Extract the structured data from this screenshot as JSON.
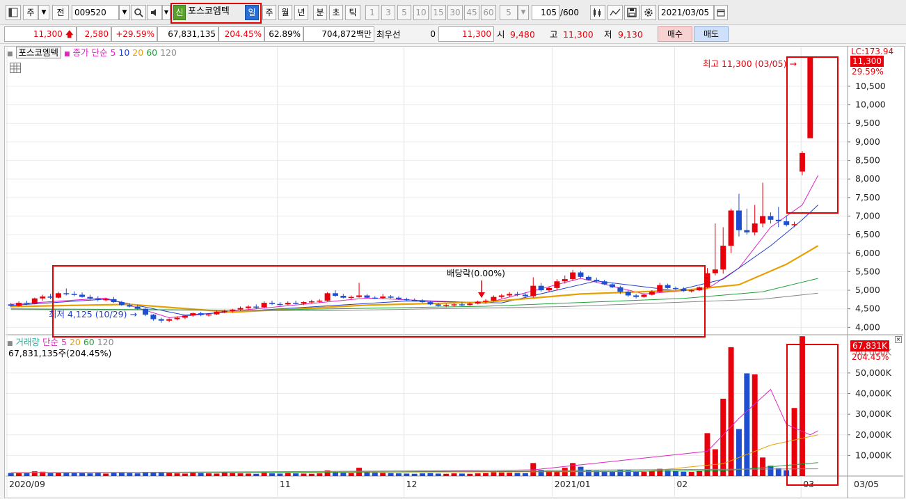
{
  "toolbar": {
    "market": "주",
    "mode": "전",
    "code": "009520",
    "credit_badge": "신",
    "stock_name": "포스코엠텍",
    "periods": [
      "일",
      "주",
      "월",
      "년",
      "분",
      "초",
      "틱"
    ],
    "minute_options": [
      "1",
      "3",
      "5",
      "10",
      "15",
      "30",
      "45",
      "60"
    ],
    "count_select": "5",
    "count_value": "105",
    "count_total": "/600",
    "date": "2021/03/05",
    "icons": [
      "window-icon",
      "search-icon",
      "volume-icon",
      "candle-settings-icon",
      "line-chart-icon",
      "save-icon",
      "gear-icon",
      "calendar-icon"
    ]
  },
  "quote": {
    "price": "11,300",
    "change": "2,580",
    "change_rate": "+29.59%",
    "volume": "67,831,135",
    "volume_ratio": "204.45%",
    "turnover": "62.89%",
    "amount": "704,872백만",
    "priority_label": "최우선",
    "priority_value": "0",
    "price2": "11,300",
    "open_label": "시",
    "open": "9,480",
    "high_label": "고",
    "high": "11,300",
    "low_label": "저",
    "low": "9,130",
    "buy": "매수",
    "sell": "매도"
  },
  "price_panel": {
    "legend_stock": "포스코엠텍",
    "legend_ma_title": "종가 단순",
    "legend_ma_periods": [
      "5",
      "10",
      "20",
      "60",
      "120"
    ],
    "y_ticks": [
      "10,500",
      "10,000",
      "9,500",
      "9,000",
      "8,500",
      "8,000",
      "7,500",
      "7,000",
      "6,500",
      "6,000",
      "5,500",
      "5,000",
      "4,500",
      "4,000"
    ],
    "lc_label": "LC:173.94",
    "last_price_tag": "11,300",
    "last_rate_tag": "29.59%",
    "high_annotation": "최고 11,300 (03/05)",
    "low_annotation": "최저 4,125 (10/29)",
    "dividend_annotation": "배당락(0.00%)"
  },
  "volume_panel": {
    "legend_title": "거래량",
    "legend_ma_title": "단순",
    "legend_ma_periods": [
      "5",
      "20",
      "60",
      "120"
    ],
    "info": "67,831,135주(204.45%)",
    "y_ticks": [
      "50,000K",
      "40,000K",
      "30,000K",
      "20,000K",
      "10,000K"
    ],
    "cut_tick": "60,000K",
    "last_tag": "67,831K",
    "last_rate_tag": "204.45%"
  },
  "x_axis": {
    "labels": [
      "2020/09",
      "11",
      "12",
      "2021/01",
      "02",
      "03"
    ],
    "last_label": "03/05"
  },
  "colors": {
    "up": "#e8000b",
    "down": "#1f4fd1",
    "ma5": "#e026c0",
    "ma10": "#1f3fcf",
    "ma20": "#e8a000",
    "ma60": "#1fa23a",
    "ma120": "#8a8a8a",
    "highlight": "#e40000"
  },
  "chart_data": {
    "type": "candlestick",
    "date_range": [
      "2020-09-01",
      "2021-03-05"
    ],
    "ylim": [
      3800,
      11550
    ],
    "volume_ylim": [
      0,
      66500000
    ],
    "ohlc": [
      [
        4620,
        4660,
        4540,
        4580
      ],
      [
        4580,
        4700,
        4560,
        4660
      ],
      [
        4660,
        4720,
        4600,
        4640
      ],
      [
        4640,
        4800,
        4620,
        4780
      ],
      [
        4780,
        4880,
        4720,
        4830
      ],
      [
        4830,
        4900,
        4760,
        4800
      ],
      [
        4800,
        4960,
        4780,
        4920
      ],
      [
        4920,
        5050,
        4860,
        4900
      ],
      [
        4900,
        4970,
        4840,
        4880
      ],
      [
        4880,
        4940,
        4800,
        4820
      ],
      [
        4820,
        4880,
        4740,
        4780
      ],
      [
        4780,
        4840,
        4700,
        4740
      ],
      [
        4740,
        4800,
        4700,
        4760
      ],
      [
        4760,
        4820,
        4660,
        4680
      ],
      [
        4680,
        4720,
        4580,
        4600
      ],
      [
        4600,
        4650,
        4540,
        4560
      ],
      [
        4560,
        4600,
        4480,
        4500
      ],
      [
        4500,
        4520,
        4300,
        4340
      ],
      [
        4340,
        4360,
        4180,
        4220
      ],
      [
        4220,
        4260,
        4125,
        4180
      ],
      [
        4180,
        4240,
        4140,
        4220
      ],
      [
        4220,
        4300,
        4190,
        4260
      ],
      [
        4260,
        4340,
        4220,
        4320
      ],
      [
        4320,
        4400,
        4280,
        4380
      ],
      [
        4380,
        4420,
        4300,
        4330
      ],
      [
        4330,
        4380,
        4290,
        4350
      ],
      [
        4350,
        4450,
        4330,
        4420
      ],
      [
        4420,
        4480,
        4380,
        4440
      ],
      [
        4440,
        4500,
        4400,
        4480
      ],
      [
        4480,
        4560,
        4440,
        4520
      ],
      [
        4520,
        4600,
        4480,
        4560
      ],
      [
        4560,
        4620,
        4500,
        4540
      ],
      [
        4540,
        4700,
        4520,
        4660
      ],
      [
        4660,
        4720,
        4600,
        4630
      ],
      [
        4630,
        4680,
        4580,
        4620
      ],
      [
        4620,
        4700,
        4600,
        4660
      ],
      [
        4660,
        4720,
        4620,
        4640
      ],
      [
        4640,
        4700,
        4600,
        4680
      ],
      [
        4680,
        4740,
        4640,
        4700
      ],
      [
        4700,
        4760,
        4660,
        4720
      ],
      [
        4720,
        4950,
        4700,
        4920
      ],
      [
        4920,
        5000,
        4820,
        4850
      ],
      [
        4850,
        4900,
        4780,
        4800
      ],
      [
        4800,
        4860,
        4760,
        4820
      ],
      [
        4820,
        5200,
        4800,
        4860
      ],
      [
        4860,
        4900,
        4780,
        4800
      ],
      [
        4800,
        4840,
        4760,
        4790
      ],
      [
        4790,
        4900,
        4760,
        4830
      ],
      [
        4830,
        4870,
        4780,
        4800
      ],
      [
        4800,
        4840,
        4740,
        4760
      ],
      [
        4760,
        4800,
        4720,
        4740
      ],
      [
        4740,
        4780,
        4700,
        4720
      ],
      [
        4720,
        4760,
        4660,
        4680
      ],
      [
        4680,
        4720,
        4600,
        4620
      ],
      [
        4620,
        4660,
        4560,
        4580
      ],
      [
        4580,
        4640,
        4540,
        4600
      ],
      [
        4600,
        4650,
        4560,
        4620
      ],
      [
        4620,
        4680,
        4570,
        4600
      ],
      [
        4600,
        4680,
        4580,
        4640
      ],
      [
        4640,
        4720,
        4620,
        4690
      ],
      [
        4690,
        4760,
        4650,
        4720
      ],
      [
        4720,
        4860,
        4700,
        4820
      ],
      [
        4820,
        4900,
        4780,
        4860
      ],
      [
        4860,
        4950,
        4820,
        4900
      ],
      [
        4900,
        4960,
        4840,
        4880
      ],
      [
        4880,
        4940,
        4800,
        4840
      ],
      [
        4840,
        5350,
        4800,
        5120
      ],
      [
        5120,
        5200,
        4960,
        5000
      ],
      [
        5000,
        5100,
        4950,
        5060
      ],
      [
        5060,
        5300,
        5000,
        5240
      ],
      [
        5240,
        5400,
        5180,
        5300
      ],
      [
        5300,
        5550,
        5250,
        5480
      ],
      [
        5480,
        5520,
        5320,
        5360
      ],
      [
        5360,
        5400,
        5260,
        5280
      ],
      [
        5280,
        5340,
        5200,
        5240
      ],
      [
        5240,
        5280,
        5140,
        5160
      ],
      [
        5160,
        5200,
        5060,
        5080
      ],
      [
        5080,
        5120,
        4900,
        4960
      ],
      [
        4960,
        5000,
        4820,
        4860
      ],
      [
        4860,
        4900,
        4780,
        4820
      ],
      [
        4820,
        4920,
        4800,
        4880
      ],
      [
        4880,
        5000,
        4860,
        4960
      ],
      [
        4960,
        5200,
        4940,
        5140
      ],
      [
        5140,
        5180,
        5040,
        5060
      ],
      [
        5060,
        5100,
        5000,
        5040
      ],
      [
        5040,
        5080,
        4960,
        4980
      ],
      [
        4980,
        5020,
        4940,
        5000
      ],
      [
        5000,
        5100,
        4980,
        5080
      ],
      [
        5080,
        5600,
        5060,
        5460
      ],
      [
        5460,
        6800,
        5400,
        5560
      ],
      [
        5560,
        6700,
        5450,
        6200
      ],
      [
        6200,
        7200,
        6000,
        7150
      ],
      [
        7150,
        7600,
        6450,
        6620
      ],
      [
        6620,
        7200,
        6500,
        6560
      ],
      [
        6560,
        7300,
        6480,
        6800
      ],
      [
        6800,
        7900,
        6700,
        7000
      ],
      [
        7000,
        7100,
        6800,
        6900
      ],
      [
        6900,
        7250,
        6700,
        6860
      ],
      [
        6860,
        7020,
        6720,
        6760
      ],
      [
        6760,
        6850,
        6700,
        6780
      ],
      [
        8200,
        8750,
        8100,
        8700
      ],
      [
        9100,
        11300,
        9130,
        11300
      ]
    ],
    "volume": [
      1500000,
      1800000,
      1400000,
      2300000,
      2100000,
      1600000,
      1700000,
      1900000,
      1500000,
      1400000,
      1300000,
      1500000,
      1200000,
      1600000,
      1800000,
      1400000,
      1300000,
      2000000,
      1700000,
      1600000,
      1400000,
      1300000,
      1200000,
      1500000,
      1400000,
      1300000,
      1200000,
      1600000,
      1400000,
      1300000,
      1200000,
      1100000,
      1500000,
      1300000,
      1200000,
      1400000,
      1300000,
      1200000,
      1100000,
      1300000,
      2700000,
      2000000,
      1500000,
      1400000,
      4000000,
      1800000,
      1600000,
      1500000,
      1400000,
      1300000,
      1200000,
      1100000,
      1300000,
      1400000,
      1200000,
      1100000,
      1300000,
      1200000,
      1100000,
      1300000,
      1400000,
      1800000,
      1700000,
      1600000,
      1500000,
      1400000,
      6300000,
      3000000,
      2400000,
      2100000,
      4000000,
      6300000,
      4500000,
      3000000,
      2600000,
      2400000,
      2100000,
      3200000,
      2800000,
      2200000,
      2000000,
      2300000,
      3500000,
      2800000,
      2400000,
      2100000,
      2000000,
      2600000,
      20800000,
      13000000,
      37500000,
      62500000,
      22800000,
      49800000,
      49300000,
      9000000,
      5000000,
      3800000,
      2800000,
      33000000,
      67800000
    ],
    "ma": {
      "5": [
        [
          0,
          4620
        ],
        [
          12,
          4790
        ],
        [
          20,
          4260
        ],
        [
          30,
          4480
        ],
        [
          45,
          4790
        ],
        [
          60,
          4650
        ],
        [
          72,
          5320
        ],
        [
          80,
          4900
        ],
        [
          88,
          5040
        ],
        [
          92,
          5600
        ],
        [
          96,
          6700
        ],
        [
          100,
          7300
        ],
        [
          102,
          8100
        ]
      ],
      "10": [
        [
          0,
          4590
        ],
        [
          12,
          4760
        ],
        [
          22,
          4330
        ],
        [
          34,
          4500
        ],
        [
          50,
          4710
        ],
        [
          62,
          4660
        ],
        [
          74,
          5250
        ],
        [
          84,
          4990
        ],
        [
          90,
          5300
        ],
        [
          96,
          6200
        ],
        [
          100,
          6900
        ],
        [
          102,
          7300
        ]
      ],
      "20": [
        [
          0,
          4560
        ],
        [
          15,
          4620
        ],
        [
          28,
          4410
        ],
        [
          45,
          4600
        ],
        [
          60,
          4680
        ],
        [
          72,
          4900
        ],
        [
          85,
          5000
        ],
        [
          92,
          5150
        ],
        [
          98,
          5700
        ],
        [
          102,
          6200
        ]
      ],
      "60": [
        [
          0,
          4500
        ],
        [
          30,
          4460
        ],
        [
          60,
          4570
        ],
        [
          85,
          4780
        ],
        [
          95,
          4960
        ],
        [
          102,
          5320
        ]
      ],
      "120": [
        [
          0,
          4480
        ],
        [
          40,
          4450
        ],
        [
          70,
          4560
        ],
        [
          95,
          4760
        ],
        [
          102,
          4920
        ]
      ]
    },
    "volume_ma": {
      "5": [
        [
          0,
          1700000
        ],
        [
          44,
          1800000
        ],
        [
          66,
          3000000
        ],
        [
          88,
          12000000
        ],
        [
          92,
          28000000
        ],
        [
          96,
          42000000
        ],
        [
          98,
          25000000
        ],
        [
          101,
          20000000
        ],
        [
          102,
          22000000
        ]
      ],
      "20": [
        [
          0,
          1600000
        ],
        [
          80,
          2200000
        ],
        [
          90,
          6000000
        ],
        [
          96,
          15000000
        ],
        [
          102,
          20000000
        ]
      ],
      "60": [
        [
          0,
          1500000
        ],
        [
          90,
          2500000
        ],
        [
          102,
          6500000
        ]
      ],
      "120": [
        [
          0,
          1500000
        ],
        [
          102,
          3500000
        ]
      ]
    }
  }
}
